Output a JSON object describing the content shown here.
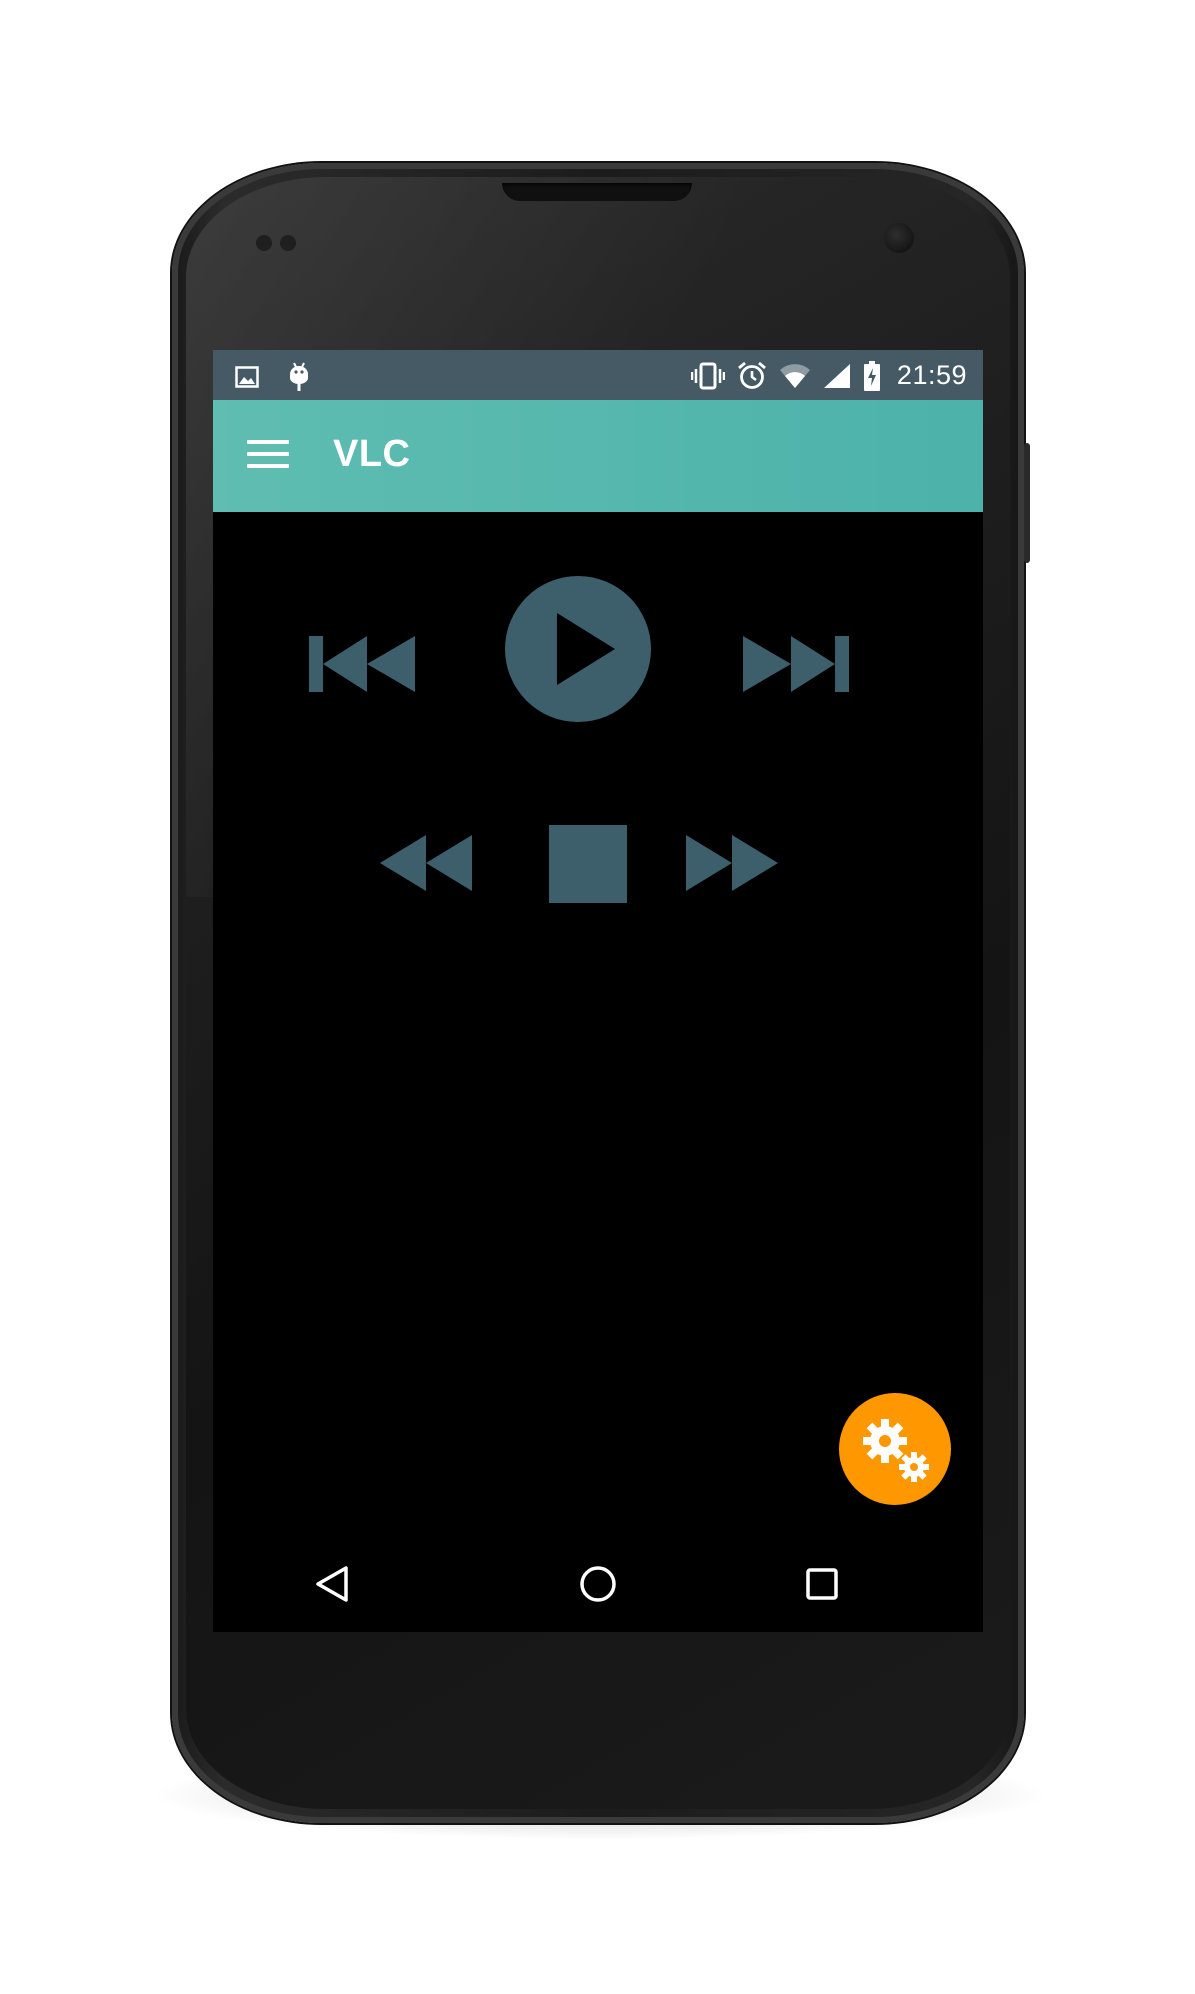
{
  "status_bar": {
    "time": "21:59",
    "left_icons": [
      "image-icon",
      "android-debug-icon"
    ],
    "right_icons": [
      "vibrate-icon",
      "alarm-icon",
      "wifi-icon",
      "signal-icon",
      "battery-charging-icon"
    ]
  },
  "app_bar": {
    "title": "VLC",
    "menu_icon": "hamburger-menu-icon"
  },
  "controls": {
    "row1": [
      "skip-previous-icon",
      "play-icon",
      "skip-next-icon"
    ],
    "row2": [
      "rewind-icon",
      "stop-icon",
      "fast-forward-icon"
    ]
  },
  "fab": {
    "icon": "settings-gears-icon"
  },
  "nav_bar": [
    "back-icon",
    "home-icon",
    "recents-icon"
  ],
  "colors": {
    "status_bar": "#455a64",
    "app_bar": "#4db6ac",
    "control": "#3d5e6b",
    "fab": "#ff9800",
    "screen_background": "#000000"
  }
}
